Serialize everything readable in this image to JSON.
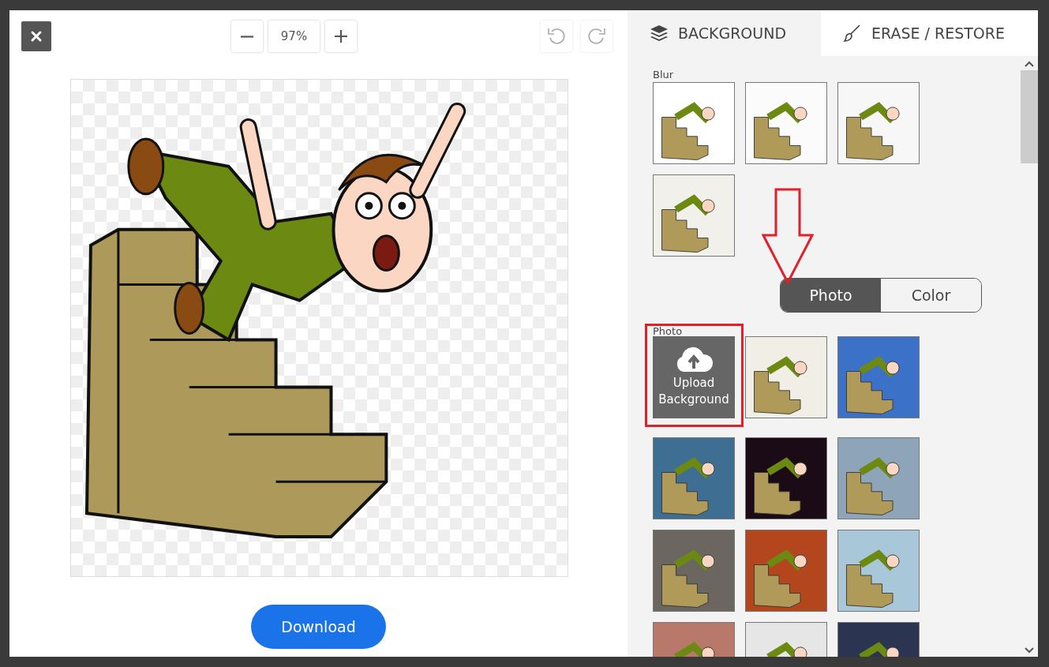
{
  "toolbar": {
    "zoom_value": "97%"
  },
  "download": "Download",
  "tabs": [
    {
      "label": "BACKGROUND",
      "selected": true,
      "kind": "layers"
    },
    {
      "label": "ERASE / RESTORE",
      "selected": false,
      "kind": "brush"
    }
  ],
  "blur": {
    "label": "Blur",
    "thumbnails": [
      {
        "color": "#ffffff"
      },
      {
        "color": "#fbfbfb"
      },
      {
        "color": "#f7f7f7"
      },
      {
        "color": "#f2f0ea"
      }
    ]
  },
  "segments": [
    {
      "label": "Photo",
      "selected": true
    },
    {
      "label": "Color",
      "selected": false
    }
  ],
  "photo": {
    "label": "Photo",
    "upload": "Upload Background",
    "thumbnails": [
      {
        "color": "#f1eee6"
      },
      {
        "color": "#3b72c8"
      },
      {
        "color": "#3e6f93"
      },
      {
        "color": "#1b0b16"
      },
      {
        "color": "#8ea4b8"
      },
      {
        "color": "#6c6660"
      },
      {
        "color": "#b4461e"
      },
      {
        "color": "#a8c8da"
      },
      {
        "color": "#b8786a"
      },
      {
        "color": "#e6e6e6"
      },
      {
        "color": "#2b3552"
      }
    ]
  }
}
